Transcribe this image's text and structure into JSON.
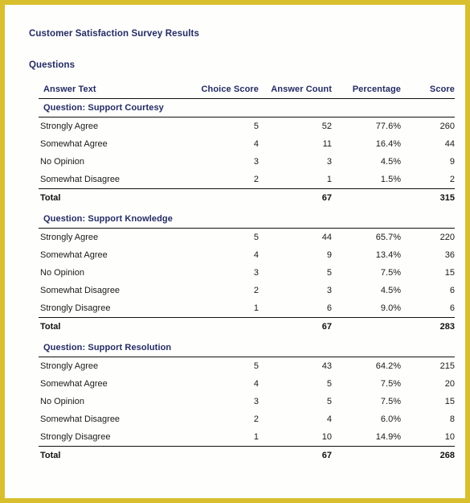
{
  "document": {
    "title": "Customer Satisfaction Survey Results",
    "section_heading": "Questions"
  },
  "colors": {
    "page_border": "#d9bf2e",
    "heading_text": "#242b63",
    "body_text": "#1a1a1a",
    "rule": "#111111",
    "page_background": "#fefefd"
  },
  "table": {
    "columns": [
      {
        "key": "answer_text",
        "label": "Answer Text",
        "align": "left"
      },
      {
        "key": "choice_score",
        "label": "Choice Score",
        "align": "right"
      },
      {
        "key": "answer_count",
        "label": "Answer Count",
        "align": "right"
      },
      {
        "key": "percentage",
        "label": "Percentage",
        "align": "right"
      },
      {
        "key": "score",
        "label": "Score",
        "align": "right"
      }
    ],
    "total_label": "Total",
    "blocks": [
      {
        "question": "Question: Support Courtesy",
        "rows": [
          {
            "answer_text": "Strongly Agree",
            "choice_score": "5",
            "answer_count": "52",
            "percentage": "77.6%",
            "score": "260"
          },
          {
            "answer_text": "Somewhat Agree",
            "choice_score": "4",
            "answer_count": "11",
            "percentage": "16.4%",
            "score": "44"
          },
          {
            "answer_text": "No Opinion",
            "choice_score": "3",
            "answer_count": "3",
            "percentage": "4.5%",
            "score": "9"
          },
          {
            "answer_text": "Somewhat Disagree",
            "choice_score": "2",
            "answer_count": "1",
            "percentage": "1.5%",
            "score": "2"
          }
        ],
        "total": {
          "label": "Total",
          "choice_score": "",
          "answer_count": "67",
          "percentage": "",
          "score": "315"
        }
      },
      {
        "question": "Question: Support Knowledge",
        "rows": [
          {
            "answer_text": "Strongly Agree",
            "choice_score": "5",
            "answer_count": "44",
            "percentage": "65.7%",
            "score": "220"
          },
          {
            "answer_text": "Somewhat Agree",
            "choice_score": "4",
            "answer_count": "9",
            "percentage": "13.4%",
            "score": "36"
          },
          {
            "answer_text": "No Opinion",
            "choice_score": "3",
            "answer_count": "5",
            "percentage": "7.5%",
            "score": "15"
          },
          {
            "answer_text": "Somewhat Disagree",
            "choice_score": "2",
            "answer_count": "3",
            "percentage": "4.5%",
            "score": "6"
          },
          {
            "answer_text": "Strongly Disagree",
            "choice_score": "1",
            "answer_count": "6",
            "percentage": "9.0%",
            "score": "6"
          }
        ],
        "total": {
          "label": "Total",
          "choice_score": "",
          "answer_count": "67",
          "percentage": "",
          "score": "283"
        }
      },
      {
        "question": "Question: Support Resolution",
        "rows": [
          {
            "answer_text": "Strongly Agree",
            "choice_score": "5",
            "answer_count": "43",
            "percentage": "64.2%",
            "score": "215"
          },
          {
            "answer_text": "Somewhat Agree",
            "choice_score": "4",
            "answer_count": "5",
            "percentage": "7.5%",
            "score": "20"
          },
          {
            "answer_text": "No Opinion",
            "choice_score": "3",
            "answer_count": "5",
            "percentage": "7.5%",
            "score": "15"
          },
          {
            "answer_text": "Somewhat Disagree",
            "choice_score": "2",
            "answer_count": "4",
            "percentage": "6.0%",
            "score": "8"
          },
          {
            "answer_text": "Strongly Disagree",
            "choice_score": "1",
            "answer_count": "10",
            "percentage": "14.9%",
            "score": "10"
          }
        ],
        "total": {
          "label": "Total",
          "choice_score": "",
          "answer_count": "67",
          "percentage": "",
          "score": "268"
        }
      }
    ]
  }
}
